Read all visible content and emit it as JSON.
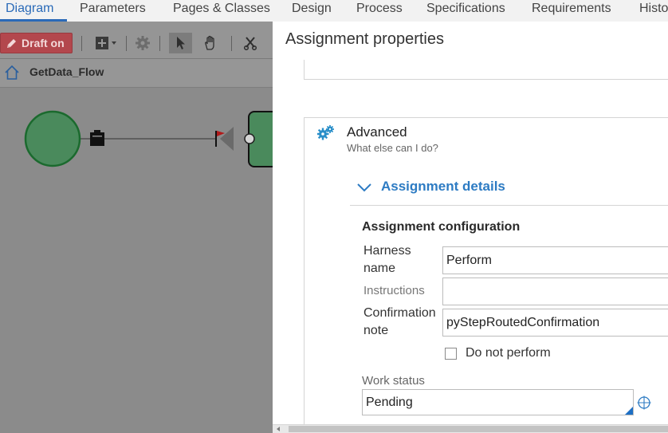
{
  "tabs": [
    {
      "label": "Diagram",
      "active": true
    },
    {
      "label": "Parameters"
    },
    {
      "label": "Pages & Classes"
    },
    {
      "label": "Design"
    },
    {
      "label": "Process"
    },
    {
      "label": "Specifications"
    },
    {
      "label": "Requirements"
    },
    {
      "label": "Histo"
    }
  ],
  "toolbar": {
    "draft_label": "Draft on",
    "icons": [
      "pencil-icon",
      "add-shape-icon",
      "gear-icon",
      "pointer-icon",
      "hand-icon",
      "cut-icon"
    ]
  },
  "breadcrumb": {
    "flow_name": "GetData_Flow",
    "icon": "home-icon"
  },
  "modal": {
    "title": "Assignment properties",
    "advanced": {
      "title": "Advanced",
      "subtitle": "What else can I do?",
      "icon": "gears-icon"
    },
    "assignment_details": {
      "label": "Assignment details",
      "expanded": true
    },
    "configuration": {
      "title": "Assignment configuration",
      "harness_label": "Harness name",
      "harness_value": "Perform",
      "instructions_label": "Instructions",
      "instructions_value": "",
      "confirmation_label": "Confirmation note",
      "confirmation_value": "pyStepRoutedConfirmation",
      "do_not_perform_label": "Do not perform",
      "do_not_perform_checked": false,
      "work_status_label": "Work status",
      "work_status_value": "Pending"
    }
  },
  "colors": {
    "accent": "#2d7bc3",
    "draft": "#b3474d",
    "node_fill": "#4a8a5c",
    "node_stroke": "#1b6a2e",
    "overlay": "#8b8b8b"
  }
}
